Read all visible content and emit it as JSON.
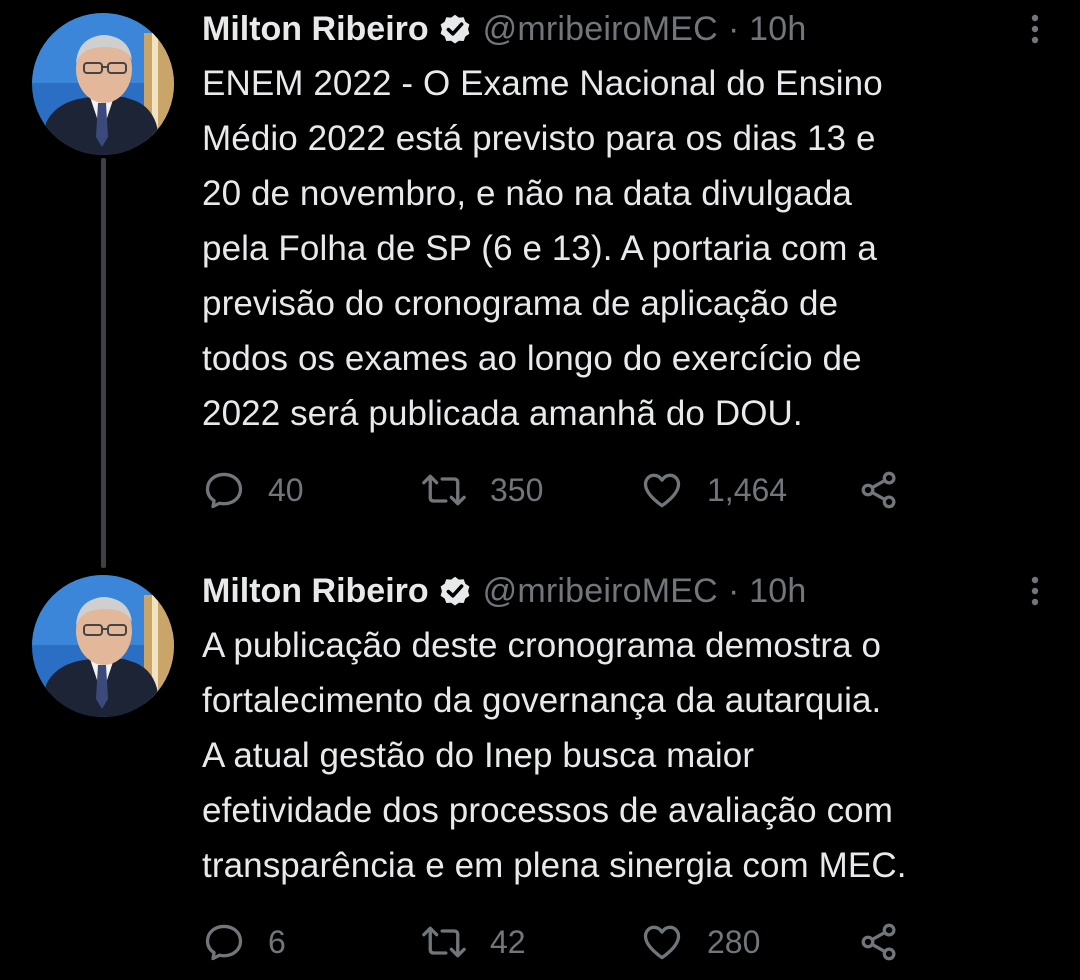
{
  "tweets": [
    {
      "author": {
        "name": "Milton Ribeiro",
        "handle": "@mribeiroMEC",
        "time": "· 10h"
      },
      "text": "ENEM 2022 - O Exame Nacional do Ensino\nMédio 2022 está previsto para os dias 13 e\n20 de novembro, e não na data divulgada\npela Folha de SP (6 e 13). A portaria com a\nprevisão do cronograma de aplicação de\ntodos os exames ao longo do exercício de\n2022 será publicada amanhã do DOU.",
      "stats": {
        "replies": "40",
        "retweets": "350",
        "likes": "1,464"
      }
    },
    {
      "author": {
        "name": "Milton Ribeiro",
        "handle": "@mribeiroMEC",
        "time": "· 10h"
      },
      "text": "A publicação deste cronograma demostra o\nfortalecimento da governança da autarquia.\nA atual gestão do Inep busca maior\nefetividade dos processos de avaliação com\ntransparência e em plena sinergia com MEC.",
      "stats": {
        "replies": "6",
        "retweets": "42",
        "likes": "280"
      }
    }
  ],
  "icons": {
    "verified": "verified-badge-icon",
    "more": "more-vertical-icon",
    "reply": "reply-bubble-icon",
    "retweet": "retweet-arrows-icon",
    "like": "heart-icon",
    "share": "share-icon"
  },
  "colors": {
    "background": "#000000",
    "text_primary": "#e7e9ea",
    "text_secondary": "#71767b",
    "thread_line": "#3e4144"
  }
}
